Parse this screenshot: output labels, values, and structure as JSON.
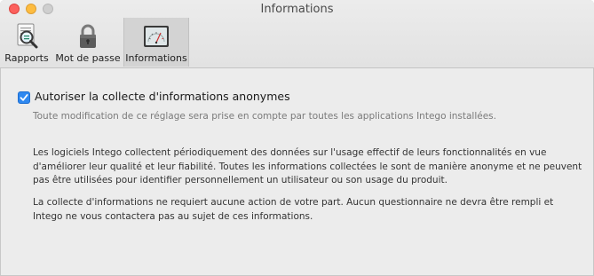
{
  "window": {
    "title": "Informations"
  },
  "toolbar": {
    "items": [
      {
        "label": "Rapports",
        "icon": "report-magnifier-icon",
        "selected": false
      },
      {
        "label": "Mot de passe",
        "icon": "padlock-icon",
        "selected": false
      },
      {
        "label": "Informations",
        "icon": "gauge-icon",
        "selected": true
      }
    ]
  },
  "settings": {
    "anonymous_info": {
      "label": "Autoriser la collecte d'informations anonymes",
      "checked": true,
      "hint": "Toute modification de ce réglage sera prise en compte par toutes les applications Intego installées."
    },
    "paragraph1": "Les logiciels Intego collectent périodiquement des données sur l'usage effectif de leurs fonctionnalités en vue d'améliorer leur qualité et leur fiabilité. Toutes les informations collectées le sont de manière anonyme et ne peuvent pas être utilisées pour identifier personnellement un utilisateur ou son usage du produit.",
    "paragraph2": "La collecte d'informations ne requiert aucune action de votre part. Aucun questionnaire ne devra être rempli et Intego ne vous contactera pas au sujet de ces informations."
  },
  "colors": {
    "accent": "#2e88f0",
    "close": "#fc605c",
    "minimize": "#fdbc40",
    "window_bg": "#ececec"
  }
}
